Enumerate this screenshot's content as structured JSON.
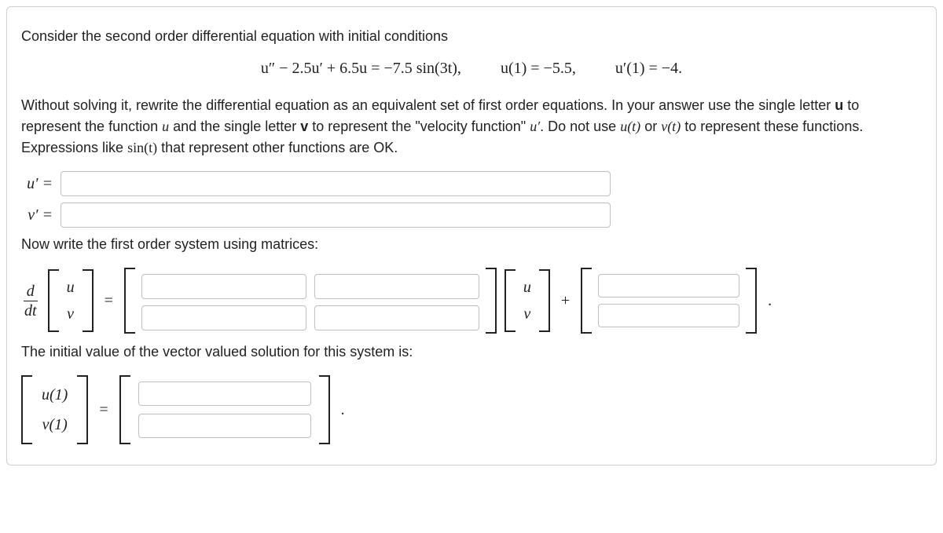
{
  "intro": "Consider the second order differential equation with initial conditions",
  "equation": {
    "ode": "u″ − 2.5u′ + 6.5u = −7.5 sin(3t),",
    "ic1": "u(1) = −5.5,",
    "ic2": "u′(1) = −4."
  },
  "para2_parts": {
    "a": "Without solving it, rewrite the differential equation as an equivalent set of first order equations. In your answer use the single letter ",
    "b": " to represent the function ",
    "c": " and the single letter ",
    "d": " to represent the \"velocity function\" ",
    "e": ". Do not use ",
    "f": " or ",
    "g": " to represent these functions. Expressions like ",
    "h": " that represent other functions are OK."
  },
  "bold_u": "u",
  "bold_v": "v",
  "math_u": "u",
  "math_uprime": "u′",
  "math_ut": "u(t)",
  "math_vt": "v(t)",
  "math_sint": "sin(t)",
  "labels": {
    "uprime_eq": "u′ =",
    "vprime_eq": "v′ ="
  },
  "para3": "Now write the first order system using matrices:",
  "ddt": {
    "num": "d",
    "den": "dt"
  },
  "vec_uv": {
    "top": "u",
    "bottom": "v"
  },
  "eq_sign": "=",
  "plus_sign": "+",
  "period": ".",
  "para4": "The initial value of the vector valued solution for this system is:",
  "iv_vec": {
    "top": "u(1)",
    "bottom": "v(1)"
  }
}
